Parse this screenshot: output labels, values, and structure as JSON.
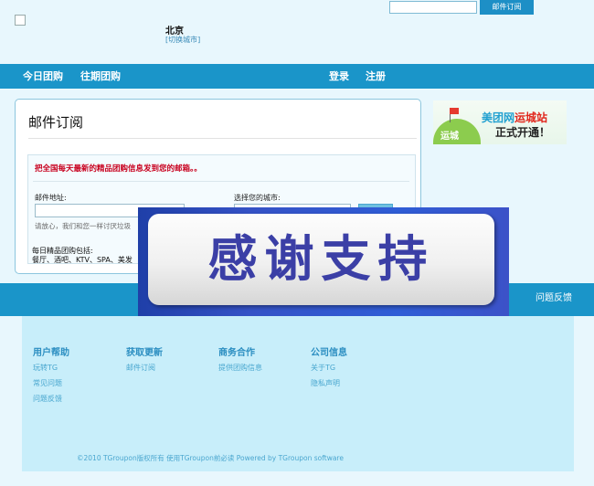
{
  "header": {
    "city": "北京",
    "switch_city": "[切换城市]",
    "subscribe_button": "邮件订阅"
  },
  "nav": {
    "today": "今日团购",
    "past": "往期团购",
    "login": "登录",
    "register": "注册"
  },
  "panel": {
    "title": "邮件订阅",
    "notice": "把全国每天最新的精品团购信息发到您的邮箱。。",
    "email_label": "邮件地址:",
    "privacy_note": "请放心，我们和您一样讨厌垃圾",
    "city_label": "选择您的城市:",
    "daily_title": "每日精品团购包括:",
    "daily_items": "餐厅、酒吧、KTV、SPA、美发"
  },
  "ad": {
    "hill_text": "运城",
    "line1_prefix": "美团网",
    "line1_highlight": "运城站",
    "line2": "正式开通！"
  },
  "footer_bar": {
    "feedback": "问题反馈"
  },
  "footer": {
    "columns": [
      {
        "title": "用户帮助",
        "links": [
          "玩转TG",
          "常见问题",
          "问题反馈"
        ]
      },
      {
        "title": "获取更新",
        "links": [
          "邮件订阅"
        ]
      },
      {
        "title": "商务合作",
        "links": [
          "提供团购信息"
        ]
      },
      {
        "title": "公司信息",
        "links": [
          "关于TG",
          "隐私声明"
        ]
      }
    ],
    "copyright": "©2010 TGroupon版权所有 使用TGroupon前必读 Powered by TGroupon software"
  },
  "overlay": {
    "text": "感谢支持"
  }
}
